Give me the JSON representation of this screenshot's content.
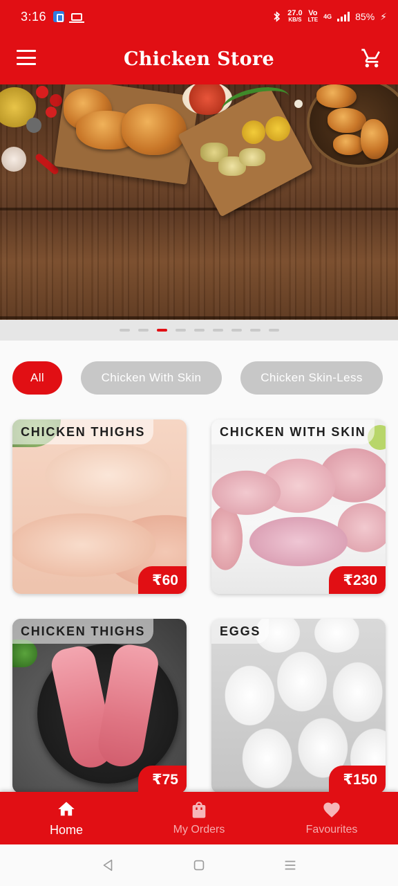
{
  "status_bar": {
    "time": "3:16",
    "speed_value": "27.0",
    "speed_unit": "KB/S",
    "network_top": "Vo",
    "network_bottom": "LTE",
    "network_type": "4G",
    "battery": "85%"
  },
  "app_bar": {
    "title": "Chicken Store",
    "menu_icon": "menu-icon",
    "cart_icon": "cart-icon"
  },
  "banner": {
    "page_count": 9,
    "active_page": 3
  },
  "filters": [
    {
      "label": "All",
      "active": true
    },
    {
      "label": "Chicken With Skin",
      "active": false
    },
    {
      "label": "Chicken Skin-Less",
      "active": false
    }
  ],
  "products": [
    {
      "name": "CHICKEN THIGHS",
      "price": "₹60"
    },
    {
      "name": "CHICKEN WITH SKIN",
      "price": "₹230"
    },
    {
      "name": "CHICKEN THIGHS",
      "price": "₹75"
    },
    {
      "name": "EGGS",
      "price": "₹150"
    }
  ],
  "bottom_nav": [
    {
      "label": "Home",
      "icon": "home-icon",
      "active": true
    },
    {
      "label": "My Orders",
      "icon": "shopping-bag-icon",
      "active": false
    },
    {
      "label": "Favourites",
      "icon": "heart-icon",
      "active": false
    }
  ],
  "colors": {
    "brand_red": "#e10f14",
    "chip_inactive": "#c7c7c7",
    "pager_inactive": "#c9c9c9"
  }
}
